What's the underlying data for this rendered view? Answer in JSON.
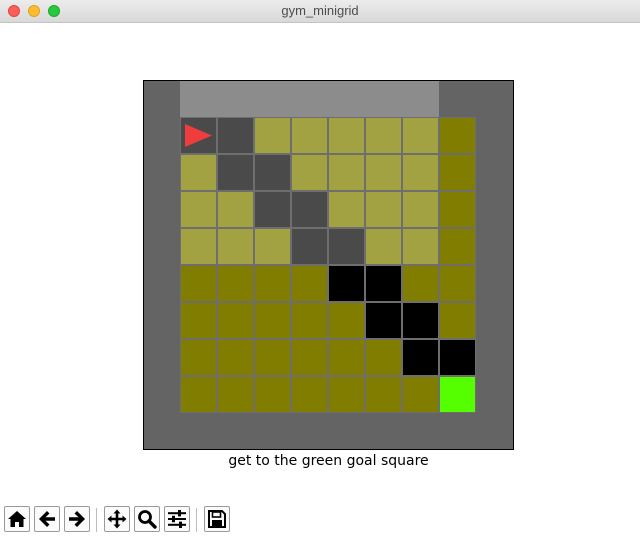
{
  "window": {
    "title": "gym_minigrid"
  },
  "mission": "get to the green goal square",
  "grid": {
    "rows": [
      [
        "agent",
        "dark",
        "lit",
        "lit",
        "lit",
        "lit",
        "lit",
        "olive"
      ],
      [
        "lit",
        "dark",
        "dark",
        "lit",
        "lit",
        "lit",
        "lit",
        "olive"
      ],
      [
        "lit",
        "lit",
        "dark",
        "dark",
        "lit",
        "lit",
        "lit",
        "olive"
      ],
      [
        "lit",
        "lit",
        "lit",
        "dark",
        "dark",
        "lit",
        "lit",
        "olive"
      ],
      [
        "olive",
        "olive",
        "olive",
        "olive",
        "black",
        "black",
        "olive",
        "olive"
      ],
      [
        "olive",
        "olive",
        "olive",
        "olive",
        "olive",
        "black",
        "black",
        "olive"
      ],
      [
        "olive",
        "olive",
        "olive",
        "olive",
        "olive",
        "olive",
        "black",
        "black"
      ],
      [
        "olive",
        "olive",
        "olive",
        "olive",
        "olive",
        "olive",
        "olive",
        "goal"
      ]
    ],
    "colors": {
      "lit": "#a3a243",
      "dark": "#4a4a4a",
      "olive": "#807d00",
      "black": "#000000",
      "goal": "#55ff00",
      "agent": "#4a4a4a",
      "wall": "#646464",
      "view_band": "#8c8c8c"
    },
    "agent": {
      "row": 0,
      "col": 0,
      "direction": "right",
      "color": "#f03c3c"
    }
  },
  "toolbar": {
    "buttons": [
      "home-icon",
      "back-arrow-icon",
      "forward-arrow-icon",
      "pan-move-icon",
      "zoom-icon",
      "configure-subplots-icon",
      "save-icon"
    ]
  }
}
